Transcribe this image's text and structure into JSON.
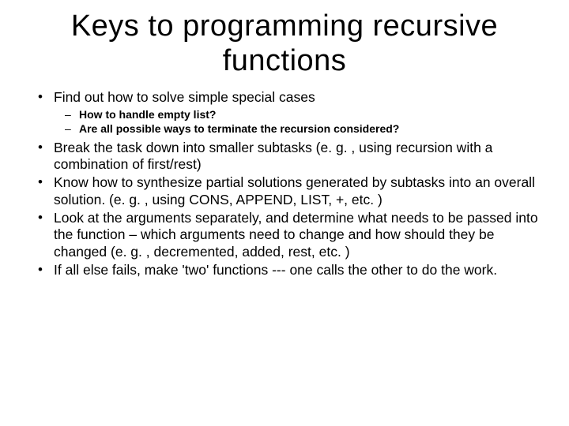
{
  "title": "Keys to programming recursive functions",
  "bullets": {
    "b0": "Find out how to solve simple special cases",
    "b0_sub0": "How to handle empty list?",
    "b0_sub1": "Are all possible ways to terminate the recursion considered?",
    "b1": "Break the task down into smaller subtasks (e. g. , using recursion with a combination of first/rest)",
    "b2": "Know how to synthesize partial solutions generated by subtasks into an overall solution. (e. g. , using CONS, APPEND, LIST, +, etc. )",
    "b3": "Look at the arguments separately, and determine what needs to be passed into the function – which arguments need to change and how should they be changed (e. g. , decremented, added, rest, etc. )",
    "b4": "If all else fails, make 'two' functions --- one calls the other to do the work."
  }
}
